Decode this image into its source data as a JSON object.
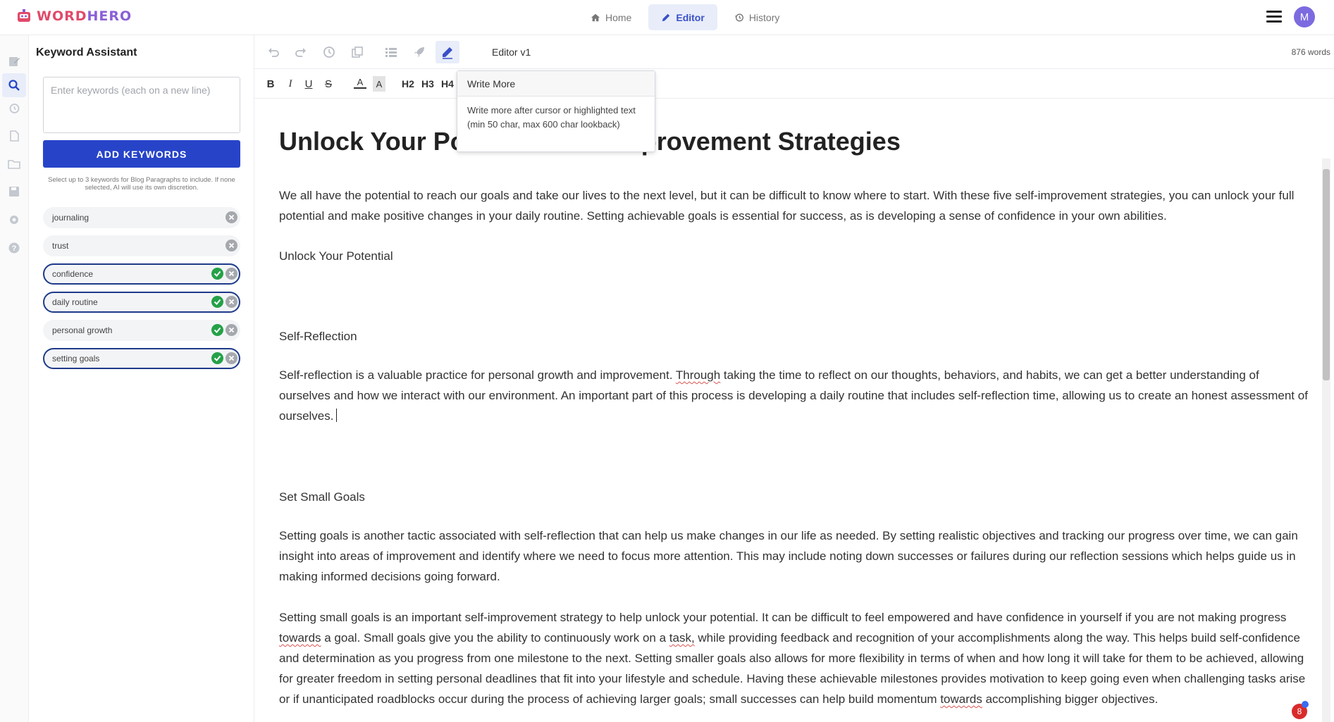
{
  "app": {
    "logo_word": "WORD",
    "logo_hero": "HERO",
    "nav": [
      {
        "label": "Home",
        "icon": "home-icon"
      },
      {
        "label": "Editor",
        "icon": "pencil-icon",
        "active": true
      },
      {
        "label": "History",
        "icon": "history-icon"
      }
    ],
    "avatar_initial": "M",
    "accent_color": "#2744c9"
  },
  "rail": {
    "items": [
      "edit-icon",
      "search-icon",
      "history-icon",
      "document-icon",
      "folder-icon",
      "save-icon",
      "gear-icon",
      "help-icon"
    ],
    "active": "search-icon"
  },
  "keywords": {
    "title": "Keyword Assistant",
    "placeholder": "Enter keywords (each on a new line)",
    "add_label": "ADD KEYWORDS",
    "help": "Select up to 3 keywords for Blog Paragraphs to include. If none selected, AI will use its own discretion.",
    "items": [
      {
        "label": "journaling",
        "used": false,
        "selected": false
      },
      {
        "label": "trust",
        "used": false,
        "selected": false
      },
      {
        "label": "confidence",
        "used": true,
        "selected": true
      },
      {
        "label": "daily routine",
        "used": true,
        "selected": true
      },
      {
        "label": "personal growth",
        "used": true,
        "selected": false
      },
      {
        "label": "setting goals",
        "used": true,
        "selected": true
      }
    ]
  },
  "toolbar": {
    "editor_name": "Editor v1",
    "word_count": "876 words",
    "buttons": [
      "undo-icon",
      "redo-icon",
      "clock-icon",
      "copy-icon",
      "list-icon",
      "rocket-icon",
      "write-more-pencil-icon"
    ],
    "format": {
      "bold": "B",
      "italic": "I",
      "underline": "U",
      "strike": "S",
      "font_color": "A",
      "highlight": "A",
      "h2": "H2",
      "h3": "H3",
      "h4": "H4"
    }
  },
  "tooltip": {
    "title": "Write More",
    "body": "Write more after cursor or highlighted text (min 50 char, max 600 char lookback)"
  },
  "document": {
    "title_left": "Unlock Your Po",
    "title_right": "provement Strategies",
    "intro": "We all have the potential to reach our goals and take our lives to the next level, but it can be difficult to know where to start. With these five self-improvement strategies, you can unlock your full potential and make positive changes in your daily routine. Setting achievable goals is essential for success, as is developing a sense of confidence in your own abilities.",
    "h_unlock": "Unlock Your Potential",
    "h_reflection": "Self-Reflection",
    "reflection_pre": "Self-reflection is a valuable practice for personal growth and improvement. ",
    "reflection_flag": "Through",
    "reflection_post": " taking the time to reflect on our thoughts, behaviors, and habits, we can get a better understanding of ourselves and how we interact with our environment. An important part of this process is developing a daily routine that includes self-reflection time, allowing us to create an honest assessment of ourselves.",
    "h_small_goals": "Set Small Goals",
    "goals_1": "Setting goals is another tactic associated with self-reflection that can help us make changes in our life as needed. By setting realistic objectives and tracking our progress over time, we can gain insight into areas of improvement and identify where we need to focus more attention. This may include noting down successes or failures during our reflection sessions which helps guide us in making informed decisions going forward.",
    "goals_2_a": "Setting small goals is an important self-improvement strategy to help unlock your potential. It can be difficult to feel empowered and have confidence in yourself if you are not making progress ",
    "goals_2_flag1": "towards",
    "goals_2_b": " a goal. Small goals give you the ability to continuously work on a ",
    "goals_2_flag2": "task,",
    "goals_2_c": " while providing feedback and recognition of your accomplishments along the way. This helps build self-confidence and determination as you progress from one milestone to the next. Setting smaller goals also allows for more flexibility in terms of when and how long it will take for them to be achieved, allowing for greater freedom in setting personal deadlines that fit into your lifestyle and schedule. Having these achievable milestones provides motivation to keep going even when challenging tasks arise or if unanticipated roadblocks occur during the process of achieving larger goals; small successes can help build momentum ",
    "goals_2_flag3": "towards",
    "goals_2_d": " accomplishing bigger objectives."
  },
  "notification_count": "8"
}
